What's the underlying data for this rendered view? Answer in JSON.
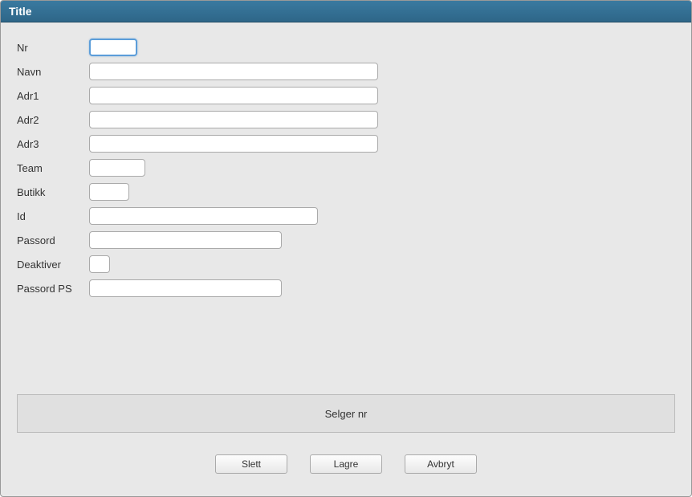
{
  "title": "Title",
  "fields": {
    "nr": {
      "label": "Nr",
      "value": ""
    },
    "navn": {
      "label": "Navn",
      "value": ""
    },
    "adr1": {
      "label": "Adr1",
      "value": ""
    },
    "adr2": {
      "label": "Adr2",
      "value": ""
    },
    "adr3": {
      "label": "Adr3",
      "value": ""
    },
    "team": {
      "label": "Team",
      "value": ""
    },
    "butikk": {
      "label": "Butikk",
      "value": ""
    },
    "id": {
      "label": "Id",
      "value": ""
    },
    "passord": {
      "label": "Passord",
      "value": ""
    },
    "deaktiver": {
      "label": "Deaktiver",
      "value": ""
    },
    "passordps": {
      "label": "Passord PS",
      "value": ""
    }
  },
  "status": "Selger nr",
  "buttons": {
    "slett": "Slett",
    "lagre": "Lagre",
    "avbryt": "Avbryt"
  }
}
